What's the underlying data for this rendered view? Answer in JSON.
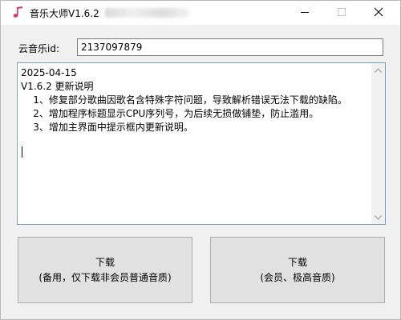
{
  "window": {
    "title": "音乐大师V1.6.2",
    "controls": {
      "minimize_icon": "minimize-icon",
      "maximize_icon": "maximize-icon",
      "close_icon": "close-icon"
    }
  },
  "form": {
    "id_label": "云音乐id:",
    "id_value": "2137097879"
  },
  "changelog": {
    "lines": [
      "2025-04-15",
      "V1.6.2 更新说明",
      "    1、修复部分歌曲因歌名含特殊字符问题，导致解析错误无法下载的缺陷。",
      "    2、增加程序标题显示CPU序列号，为后续无损做铺垫，防止滥用。",
      "    3、增加主界面中提示框内更新说明。"
    ]
  },
  "buttons": {
    "download_normal": {
      "line1": "下载",
      "line2": "(备用，仅下载非会员普通音质)"
    },
    "download_vip": {
      "line1": "下载",
      "line2": "(会员、极高音质)"
    }
  },
  "colors": {
    "app_icon": "#d6336c",
    "accent_border": "#7a9cbf"
  }
}
